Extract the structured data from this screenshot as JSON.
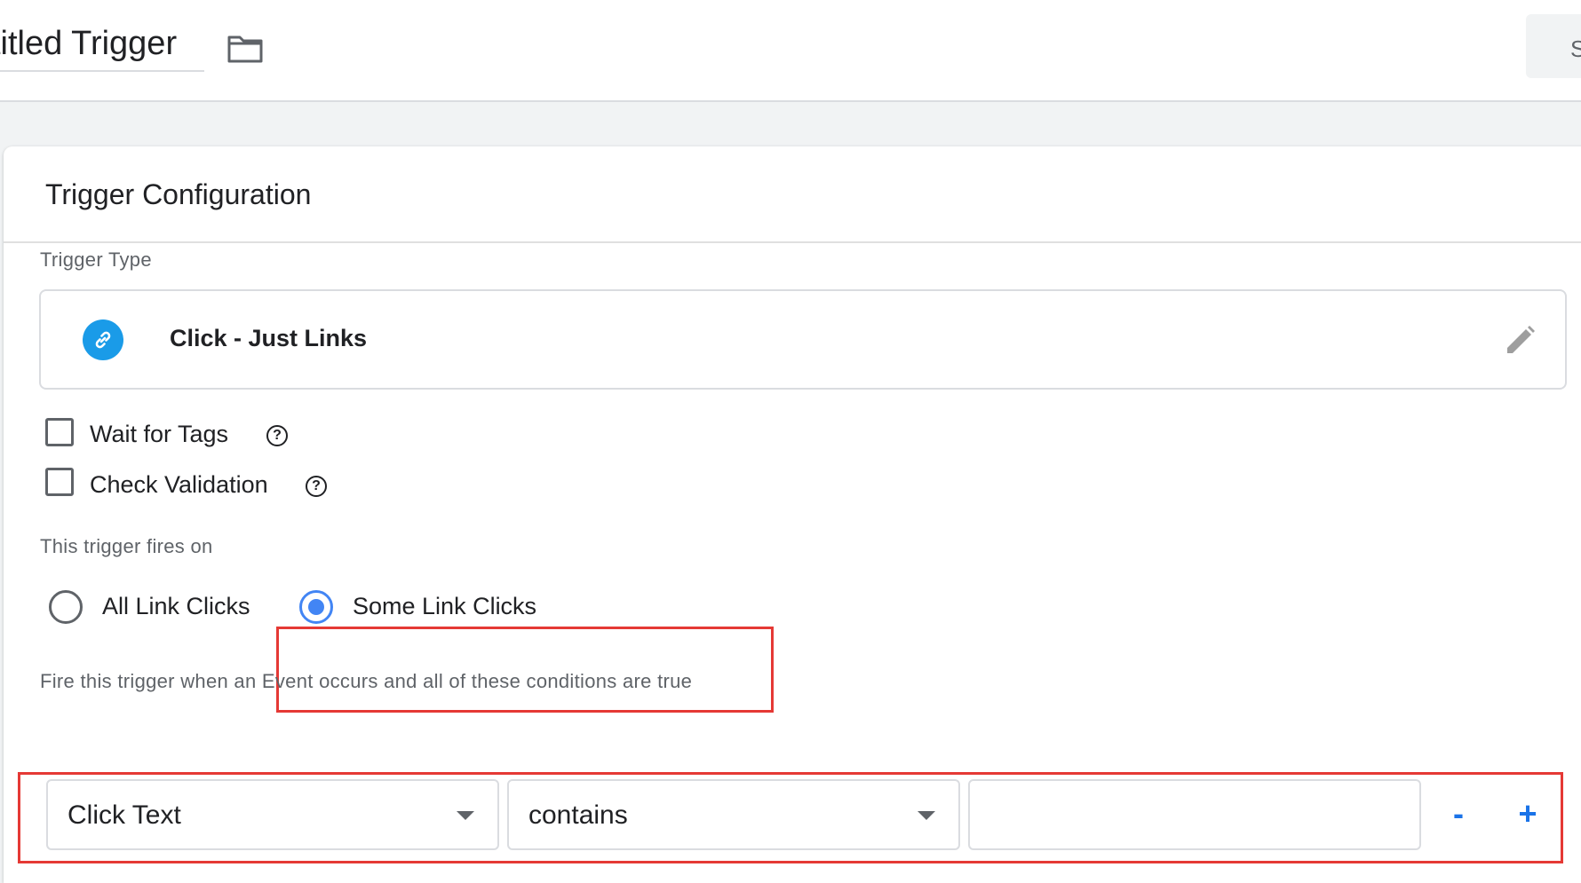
{
  "header": {
    "title": "titled Trigger",
    "save_label": "Save",
    "folder_icon": "folder-icon"
  },
  "card": {
    "title": "Trigger Configuration",
    "trigger_type_label": "Trigger Type",
    "trigger_type": {
      "name": "Click - Just Links",
      "icon": "link-icon",
      "icon_color": "#1a9be8"
    },
    "options": [
      {
        "label": "Wait for Tags",
        "checked": false
      },
      {
        "label": "Check Validation",
        "checked": false
      }
    ],
    "fires_on_label": "This trigger fires on",
    "fires_on": [
      {
        "label": "All Link Clicks",
        "selected": false
      },
      {
        "label": "Some Link Clicks",
        "selected": true
      }
    ],
    "conditions_label": "Fire this trigger when an Event occurs and all of these conditions are true",
    "condition": {
      "variable": "Click Text",
      "operator": "contains",
      "value": "",
      "remove_label": "-",
      "add_label": "+"
    }
  },
  "colors": {
    "accent": "#4285f4",
    "highlight": "#e53935",
    "link_blue": "#1a73e8"
  }
}
